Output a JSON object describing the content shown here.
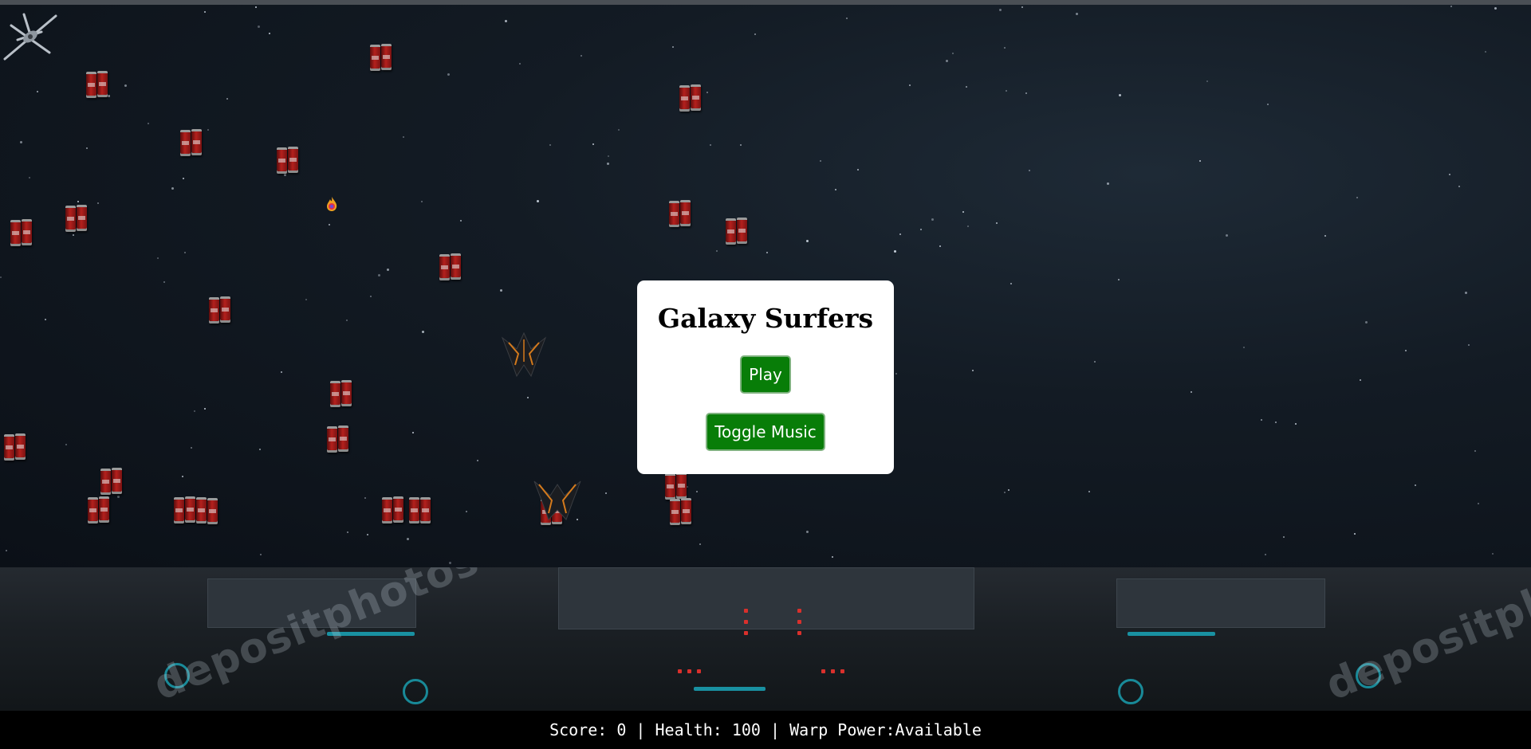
{
  "menu": {
    "title": "Galaxy Surfers",
    "play_label": "Play",
    "music_label": "Toggle Music"
  },
  "hud": {
    "status_text": "Score: 0 | Health: 100 | Warp Power:Available"
  },
  "sprites": {
    "obstacle": "soda-can-cluster",
    "player": "spaceship",
    "enemy": "enemy-ship",
    "powerup": "flame-orb"
  },
  "watermark": {
    "text": "depositphotos"
  },
  "colors": {
    "button": "#087d08",
    "background": "#0b1017",
    "hud_text": "#ffffff",
    "panel_accent": "#1aa6b8"
  }
}
